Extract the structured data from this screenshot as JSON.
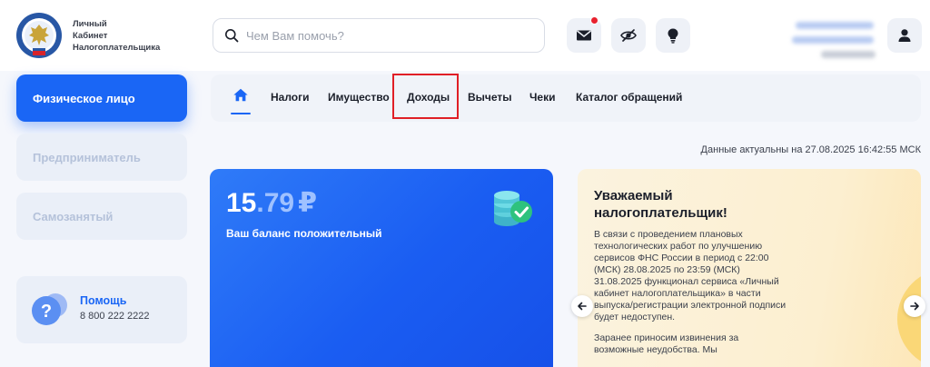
{
  "brand": {
    "line1": "Личный",
    "line2": "Кабинет",
    "line3": "Налогоплательщика"
  },
  "search": {
    "placeholder": "Чем Вам помочь?"
  },
  "sidebar": {
    "items": [
      {
        "label": "Физическое лицо",
        "active": true
      },
      {
        "label": "Предприниматель",
        "active": false
      },
      {
        "label": "Самозанятый",
        "active": false
      }
    ],
    "help": {
      "title": "Помощь",
      "phone": "8 800 222 2222"
    }
  },
  "nav": {
    "items": [
      "Налоги",
      "Имущество",
      "Доходы",
      "Вычеты",
      "Чеки",
      "Каталог обращений"
    ],
    "highlighted": "Доходы"
  },
  "status": {
    "updated": "Данные актуальны на 27.08.2025 16:42:55 МСК"
  },
  "balance": {
    "int": "15",
    "dec": ".79",
    "currency": "₽",
    "note": "Ваш баланс положительный"
  },
  "notice": {
    "title": "Уважаемый налогоплательщик!",
    "p1": "В связи с проведением плановых технологических работ по улучшению сервисов ФНС России в период с 22:00 (МСК) 28.08.2025 по 23:59 (МСК) 31.08.2025 функционал сервиса «Личный кабинет налогоплательщика» в части выпуска/регистрации электронной подписи будет недоступен.",
    "p2": "Заранее приносим извинения за возможные неудобства. Мы"
  },
  "colors": {
    "accent": "#1a66f5",
    "highlight": "#e01f26",
    "notice_bg": "#fcefd0"
  },
  "icons": {
    "search": "search-icon",
    "mail": "mail-icon",
    "eye_off": "eye-off-icon",
    "bulb": "lightbulb-icon",
    "user": "user-icon",
    "help": "question-icon",
    "coins": "coins-check-icon",
    "prev": "arrow-left-icon",
    "next": "arrow-right-icon"
  }
}
